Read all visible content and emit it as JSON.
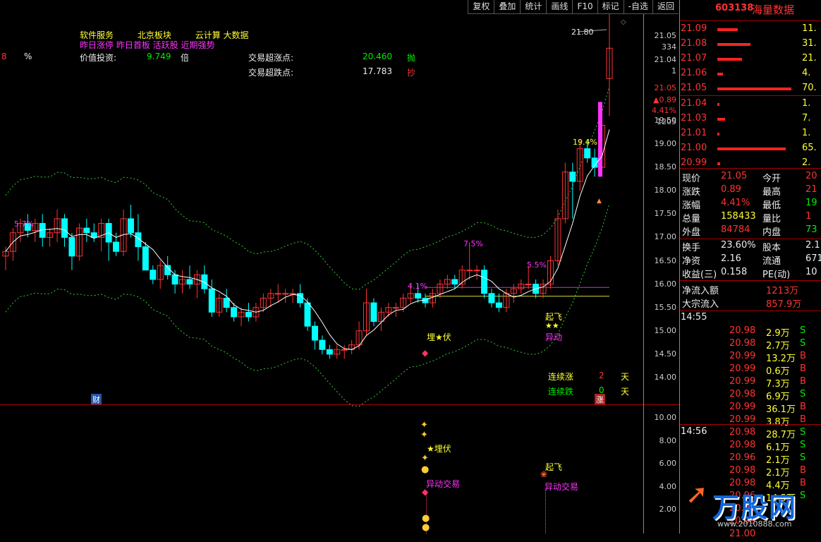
{
  "toolbar": [
    "复权",
    "叠加",
    "统计",
    "画线",
    "F10",
    "标记",
    "-自选",
    "返回"
  ],
  "indicators": {
    "line1": [
      "软件服务",
      "北京板块",
      "云计算 大数据"
    ],
    "line2": "昨日涨停 昨日首板 活跃股 近期强势",
    "value_invest_label": "价值投资:",
    "value_invest_value": "9.749",
    "value_invest_unit": "倍",
    "left_frag_num": "8",
    "left_frag_pct": "%",
    "overbuy_label": "交易超涨点:",
    "overbuy_value": "20.460",
    "overbuy_signal": "抛",
    "oversell_label": "交易超跌点:",
    "oversell_value": "17.783",
    "oversell_signal": "抄"
  },
  "annotations": {
    "high_price": "21.80",
    "pct_a": "5.7%",
    "pct_b": "4.1%",
    "pct_c": "7.5%",
    "pct_d": "5.5%",
    "pct_e": "19.4%",
    "ambush": "埋★伏",
    "takeoff": "起飞",
    "stars": "★★",
    "anomaly": "异动",
    "cai": "财",
    "zhang": "涨",
    "up_days_label": "连续涨",
    "up_days_value": "2",
    "up_days_unit": "天",
    "down_days_label": "连续跌",
    "down_days_value": "0",
    "down_days_unit": "天",
    "sub_ambush": "★埋伏",
    "sub_anomaly_trade_1": "异动交易",
    "sub_takeoff": "起飞",
    "sub_anomaly_trade_2": "异动交易"
  },
  "price_axis": {
    "top_labels": [
      "21.05",
      "334",
      "21.04",
      "1"
    ],
    "last_price": "21.05",
    "change": "▲0.89",
    "change_pct": "4.41%",
    "volume": "1205",
    "ticks": [
      "19.50",
      "19.00",
      "18.50",
      "18.00",
      "17.50",
      "17.00",
      "16.50",
      "16.00",
      "15.50",
      "15.00",
      "14.50",
      "14.00"
    ],
    "sub_ticks": [
      "10.00",
      "8.00",
      "6.00",
      "4.00",
      "2.00"
    ]
  },
  "quote": {
    "code": "603138",
    "name": "海量数据",
    "sell_orders": [
      {
        "price": "21.09",
        "bar": 0.28,
        "vol": "11."
      },
      {
        "price": "21.08",
        "bar": 0.45,
        "vol": "31."
      },
      {
        "price": "21.07",
        "bar": 0.33,
        "vol": "21."
      },
      {
        "price": "21.06",
        "bar": 0.08,
        "vol": "4."
      },
      {
        "price": "21.05",
        "bar": 1.0,
        "vol": "70."
      }
    ],
    "buy_orders": [
      {
        "price": "21.04",
        "bar": 0.03,
        "vol": "1."
      },
      {
        "price": "21.03",
        "bar": 0.1,
        "vol": "7."
      },
      {
        "price": "21.01",
        "bar": 0.03,
        "vol": "1."
      },
      {
        "price": "21.00",
        "bar": 0.92,
        "vol": "65."
      },
      {
        "price": "20.99",
        "bar": 0.04,
        "vol": "2."
      }
    ],
    "stats": [
      {
        "l1": "现价",
        "v1": "21.05",
        "c1": "red",
        "l2": "今开",
        "v2": "20",
        "c2": "red"
      },
      {
        "l1": "涨跌",
        "v1": "0.89",
        "c1": "red",
        "l2": "最高",
        "v2": "21",
        "c2": "red"
      },
      {
        "l1": "涨幅",
        "v1": "4.41%",
        "c1": "red",
        "l2": "最低",
        "v2": "19",
        "c2": "green"
      },
      {
        "l1": "总量",
        "v1": "158433",
        "c1": "yellow",
        "l2": "量比",
        "v2": "1",
        "c2": "red"
      },
      {
        "l1": "外盘",
        "v1": "84784",
        "c1": "red",
        "l2": "内盘",
        "v2": "73",
        "c2": "green"
      }
    ],
    "stats2": [
      {
        "l1": "换手",
        "v1": "23.60%",
        "l2": "股本",
        "v2": "2.1"
      },
      {
        "l1": "净资",
        "v1": "2.16",
        "l2": "流通",
        "v2": "671"
      },
      {
        "l1": "收益(三)",
        "v1": "0.158",
        "l2": "PE(动)",
        "v2": "10"
      }
    ],
    "net_inflow_label": "净流入额",
    "net_inflow_value": "1213万",
    "block_inflow_label": "大宗流入",
    "block_inflow_value": "857.9万"
  },
  "ticks_1455": {
    "time": "14:55",
    "rows": [
      {
        "p": "20.98",
        "v": "2.9万",
        "s": "S"
      },
      {
        "p": "20.98",
        "v": "2.7万",
        "s": "S"
      },
      {
        "p": "20.99",
        "v": "13.2万",
        "s": "B"
      },
      {
        "p": "20.99",
        "v": "0.6万",
        "s": "B"
      },
      {
        "p": "20.99",
        "v": "7.3万",
        "s": "B"
      },
      {
        "p": "20.98",
        "v": "6.9万",
        "s": "S"
      },
      {
        "p": "20.99",
        "v": "36.1万",
        "s": "B"
      },
      {
        "p": "20.99",
        "v": "3.8万",
        "s": "B"
      },
      {
        "p": "20.98",
        "v": "28.7万",
        "s": "S"
      }
    ]
  },
  "ticks_1456": {
    "time": "14:56",
    "rows": [
      {
        "p": "20.98",
        "v": "6.1万",
        "s": "S"
      },
      {
        "p": "20.96",
        "v": "2.1万",
        "s": "S"
      },
      {
        "p": "20.98",
        "v": "2.1万",
        "s": "B"
      },
      {
        "p": "20.98",
        "v": "4.4万",
        "s": "B"
      },
      {
        "p": "20.96",
        "v": "14.5万",
        "s": "S"
      },
      {
        "p": "20.98",
        "v": "",
        "s": ""
      },
      {
        "p": "20.99",
        "v": "",
        "s": ""
      },
      {
        "p": "21.00",
        "v": "",
        "s": ""
      }
    ]
  },
  "watermark": "万股网",
  "watermark_url": "www.2010888.com",
  "colors": {
    "up": "#ff3333",
    "down": "#00ffff",
    "ma": "#ffffff",
    "band": "#33cc33",
    "accent": "#ff33ff"
  },
  "candles": [
    [
      16.6,
      16.8,
      16.3,
      16.7
    ],
    [
      16.7,
      17.2,
      16.5,
      17.1
    ],
    [
      17.1,
      17.4,
      16.9,
      17.3
    ],
    [
      17.3,
      17.5,
      17.0,
      17.15
    ],
    [
      17.15,
      17.4,
      16.9,
      17.3
    ],
    [
      17.3,
      17.5,
      16.8,
      17.0
    ],
    [
      17.0,
      17.2,
      16.8,
      17.1
    ],
    [
      17.1,
      17.6,
      16.9,
      17.4
    ],
    [
      17.4,
      17.5,
      16.8,
      17.0
    ],
    [
      17.0,
      17.1,
      16.3,
      16.6
    ],
    [
      16.6,
      17.3,
      16.5,
      17.2
    ],
    [
      17.2,
      17.4,
      16.9,
      17.1
    ],
    [
      17.1,
      17.3,
      16.9,
      17.0
    ],
    [
      17.0,
      17.4,
      16.7,
      17.3
    ],
    [
      17.3,
      17.4,
      16.5,
      16.9
    ],
    [
      16.9,
      17.1,
      16.6,
      16.7
    ],
    [
      16.7,
      17.6,
      16.6,
      17.4
    ],
    [
      17.4,
      17.7,
      17.0,
      17.1
    ],
    [
      17.1,
      17.5,
      16.5,
      16.8
    ],
    [
      16.8,
      16.9,
      16.3,
      16.3
    ],
    [
      16.3,
      16.4,
      16.0,
      16.1
    ],
    [
      16.1,
      16.5,
      15.9,
      16.4
    ],
    [
      16.4,
      16.6,
      16.1,
      16.2
    ],
    [
      16.2,
      16.3,
      15.8,
      16.0
    ],
    [
      16.0,
      16.3,
      15.8,
      16.1
    ],
    [
      16.1,
      16.4,
      15.9,
      16.0
    ],
    [
      16.0,
      16.3,
      15.7,
      16.2
    ],
    [
      16.2,
      16.4,
      15.8,
      15.9
    ],
    [
      15.9,
      16.1,
      15.3,
      15.4
    ],
    [
      15.4,
      15.8,
      15.3,
      15.7
    ],
    [
      15.7,
      15.9,
      15.4,
      15.5
    ],
    [
      15.5,
      15.6,
      15.2,
      15.3
    ],
    [
      15.3,
      15.5,
      15.1,
      15.4
    ],
    [
      15.4,
      15.6,
      15.2,
      15.3
    ],
    [
      15.3,
      15.6,
      15.2,
      15.5
    ],
    [
      15.5,
      15.8,
      15.4,
      15.7
    ],
    [
      15.7,
      15.9,
      15.5,
      15.8
    ],
    [
      15.8,
      16.0,
      15.6,
      15.8
    ],
    [
      15.8,
      15.9,
      15.6,
      15.8
    ],
    [
      15.8,
      15.9,
      15.6,
      15.8
    ],
    [
      15.8,
      16.0,
      15.5,
      15.6
    ],
    [
      15.6,
      15.7,
      15.0,
      15.1
    ],
    [
      15.1,
      15.2,
      14.6,
      14.8
    ],
    [
      14.8,
      14.9,
      14.5,
      14.6
    ],
    [
      14.6,
      14.7,
      14.4,
      14.5
    ],
    [
      14.5,
      14.7,
      14.4,
      14.6
    ],
    [
      14.6,
      14.7,
      14.4,
      14.6
    ],
    [
      14.6,
      14.8,
      14.5,
      14.7
    ],
    [
      14.7,
      15.2,
      14.6,
      15.0
    ],
    [
      15.0,
      15.9,
      14.9,
      15.6
    ],
    [
      15.6,
      15.7,
      15.1,
      15.2
    ],
    [
      15.2,
      15.5,
      15.0,
      15.4
    ],
    [
      15.4,
      15.6,
      15.3,
      15.5
    ],
    [
      15.5,
      15.6,
      15.3,
      15.5
    ],
    [
      15.5,
      15.8,
      15.4,
      15.7
    ],
    [
      15.7,
      16.0,
      15.6,
      15.8
    ],
    [
      15.8,
      16.0,
      15.6,
      15.7
    ],
    [
      15.7,
      15.8,
      15.5,
      15.6
    ],
    [
      15.6,
      15.9,
      15.5,
      15.8
    ],
    [
      15.8,
      16.1,
      15.7,
      16.0
    ],
    [
      16.0,
      16.2,
      15.9,
      16.1
    ],
    [
      16.1,
      16.2,
      15.9,
      16.0
    ],
    [
      16.0,
      16.4,
      15.9,
      16.3
    ],
    [
      16.3,
      16.9,
      16.1,
      16.3
    ],
    [
      16.3,
      16.4,
      16.1,
      16.3
    ],
    [
      16.3,
      16.4,
      15.7,
      15.8
    ],
    [
      15.8,
      15.9,
      15.5,
      15.6
    ],
    [
      15.6,
      15.8,
      15.4,
      15.5
    ],
    [
      15.5,
      15.9,
      15.4,
      15.8
    ],
    [
      15.8,
      16.0,
      15.6,
      15.9
    ],
    [
      15.9,
      16.1,
      15.8,
      16.0
    ],
    [
      16.0,
      16.4,
      15.9,
      16.0
    ],
    [
      16.0,
      16.1,
      15.7,
      15.8
    ],
    [
      15.8,
      16.1,
      15.7,
      16.0
    ],
    [
      16.0,
      16.6,
      15.9,
      16.5
    ],
    [
      16.5,
      17.6,
      16.4,
      17.4
    ],
    [
      17.4,
      18.6,
      17.3,
      18.4
    ],
    [
      18.4,
      18.6,
      17.4,
      18.2
    ],
    [
      18.2,
      19.1,
      18.0,
      18.9
    ],
    [
      18.9,
      19.1,
      18.6,
      18.7
    ],
    [
      18.7,
      18.9,
      18.3,
      18.5
    ],
    [
      18.5,
      19.8,
      18.4,
      19.4
    ],
    [
      20.4,
      21.8,
      19.6,
      21.05
    ]
  ]
}
